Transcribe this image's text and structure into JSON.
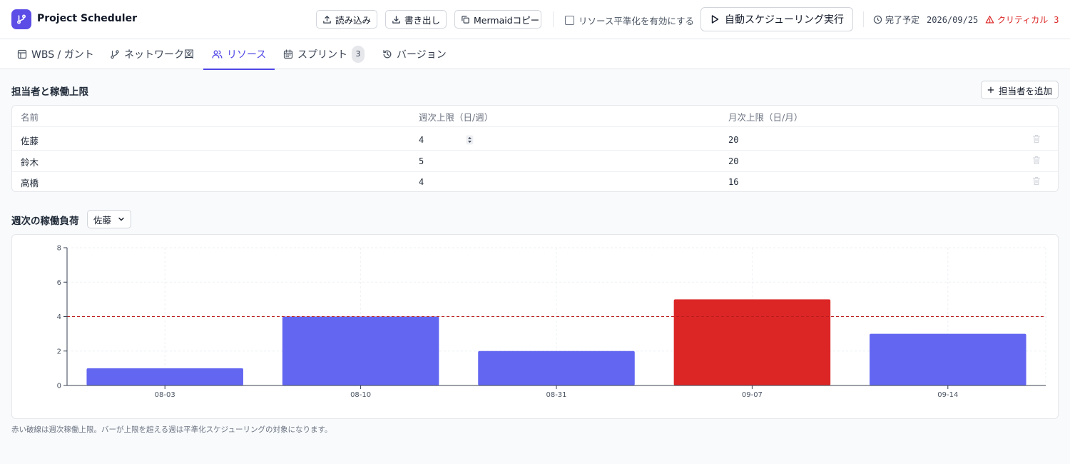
{
  "app": {
    "title": "Project Scheduler"
  },
  "toolbar": {
    "import_label": "読み込み",
    "export_label": "書き出し",
    "mermaid_label": "Mermaidコピー",
    "leveling_label": "リソース平準化を有効にする",
    "leveling_checked": false,
    "run_label": "自動スケジューリング実行",
    "due_label": "完了予定",
    "due_date": "2026/09/25",
    "critical_label": "クリティカル",
    "critical_count": "3"
  },
  "tabs": [
    {
      "label": "WBS / ガント",
      "icon": "table-icon"
    },
    {
      "label": "ネットワーク図",
      "icon": "network-icon"
    },
    {
      "label": "リソース",
      "icon": "users-icon",
      "active": true
    },
    {
      "label": "スプリント",
      "icon": "calendar-icon",
      "badge": "3"
    },
    {
      "label": "バージョン",
      "icon": "history-icon"
    }
  ],
  "assignees": {
    "title": "担当者と稼働上限",
    "add_label": "担当者を追加",
    "columns": [
      "名前",
      "週次上限（日/週）",
      "月次上限（日/月）"
    ],
    "rows": [
      {
        "name": "佐藤",
        "weekly": "4",
        "monthly": "20"
      },
      {
        "name": "鈴木",
        "weekly": "5",
        "monthly": "20"
      },
      {
        "name": "高橋",
        "weekly": "4",
        "monthly": "16"
      }
    ]
  },
  "workload": {
    "title": "週次の稼働負荷",
    "selected_person": "佐藤",
    "note": "赤い破線は週次稼働上限。バーが上限を超える週は平準化スケジューリングの対象になります。"
  },
  "chart_data": {
    "type": "bar",
    "categories": [
      "08-03",
      "08-10",
      "08-31",
      "09-07",
      "09-14"
    ],
    "values": [
      1,
      4,
      2,
      5,
      3
    ],
    "ylim": [
      0,
      8
    ],
    "yticks": [
      0,
      2,
      4,
      6,
      8
    ],
    "limit": 4,
    "grid": true,
    "title": "",
    "xlabel": "",
    "ylabel": "",
    "colors": {
      "normal": "#6366f1",
      "over": "#dc2626",
      "limit_line": "#b91c1c"
    }
  }
}
